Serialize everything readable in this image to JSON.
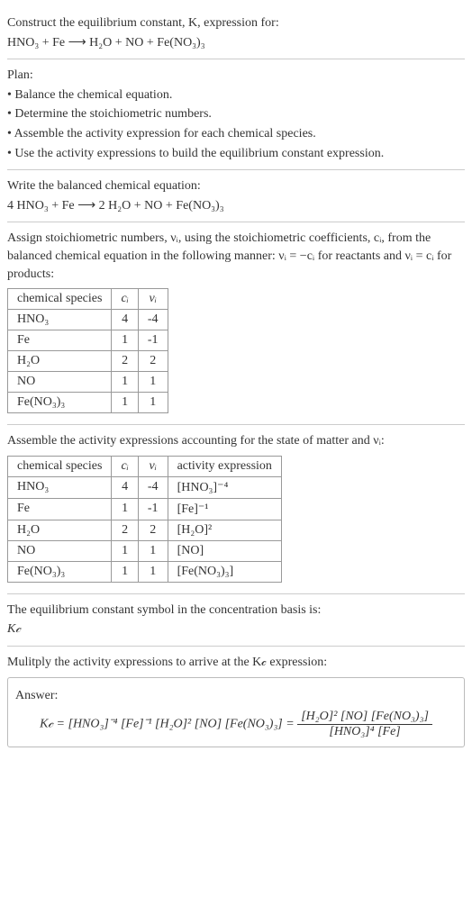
{
  "prompt": {
    "line1": "Construct the equilibrium constant, K, expression for:",
    "eq": "HNO₃ + Fe ⟶ H₂O + NO + Fe(NO₃)₃"
  },
  "plan": {
    "heading": "Plan:",
    "b1": "• Balance the chemical equation.",
    "b2": "• Determine the stoichiometric numbers.",
    "b3": "• Assemble the activity expression for each chemical species.",
    "b4": "• Use the activity expressions to build the equilibrium constant expression."
  },
  "balanced": {
    "heading": "Write the balanced chemical equation:",
    "eq": "4 HNO₃ + Fe ⟶ 2 H₂O + NO + Fe(NO₃)₃"
  },
  "stoich": {
    "intro1": "Assign stoichiometric numbers, νᵢ, using the stoichiometric coefficients, cᵢ, from the balanced chemical equation in the following manner: νᵢ = −cᵢ for reactants and νᵢ = cᵢ for products:",
    "h1": "chemical species",
    "h2": "cᵢ",
    "h3": "νᵢ",
    "rows": [
      {
        "sp": "HNO₃",
        "c": "4",
        "v": "-4"
      },
      {
        "sp": "Fe",
        "c": "1",
        "v": "-1"
      },
      {
        "sp": "H₂O",
        "c": "2",
        "v": "2"
      },
      {
        "sp": "NO",
        "c": "1",
        "v": "1"
      },
      {
        "sp": "Fe(NO₃)₃",
        "c": "1",
        "v": "1"
      }
    ]
  },
  "activity": {
    "intro": "Assemble the activity expressions accounting for the state of matter and νᵢ:",
    "h1": "chemical species",
    "h2": "cᵢ",
    "h3": "νᵢ",
    "h4": "activity expression",
    "rows": [
      {
        "sp": "HNO₃",
        "c": "4",
        "v": "-4",
        "a": "[HNO₃]⁻⁴"
      },
      {
        "sp": "Fe",
        "c": "1",
        "v": "-1",
        "a": "[Fe]⁻¹"
      },
      {
        "sp": "H₂O",
        "c": "2",
        "v": "2",
        "a": "[H₂O]²"
      },
      {
        "sp": "NO",
        "c": "1",
        "v": "1",
        "a": "[NO]"
      },
      {
        "sp": "Fe(NO₃)₃",
        "c": "1",
        "v": "1",
        "a": "[Fe(NO₃)₃]"
      }
    ]
  },
  "symbol": {
    "line1": "The equilibrium constant symbol in the concentration basis is:",
    "kc": "K𝒸"
  },
  "final": {
    "intro": "Mulitply the activity expressions to arrive at the K𝒸 expression:",
    "answerLabel": "Answer:",
    "lhs": "K𝒸 = [HNO₃]⁻⁴ [Fe]⁻¹ [H₂O]² [NO] [Fe(NO₃)₃] = ",
    "num": "[H₂O]² [NO] [Fe(NO₃)₃]",
    "den": "[HNO₃]⁴ [Fe]"
  }
}
